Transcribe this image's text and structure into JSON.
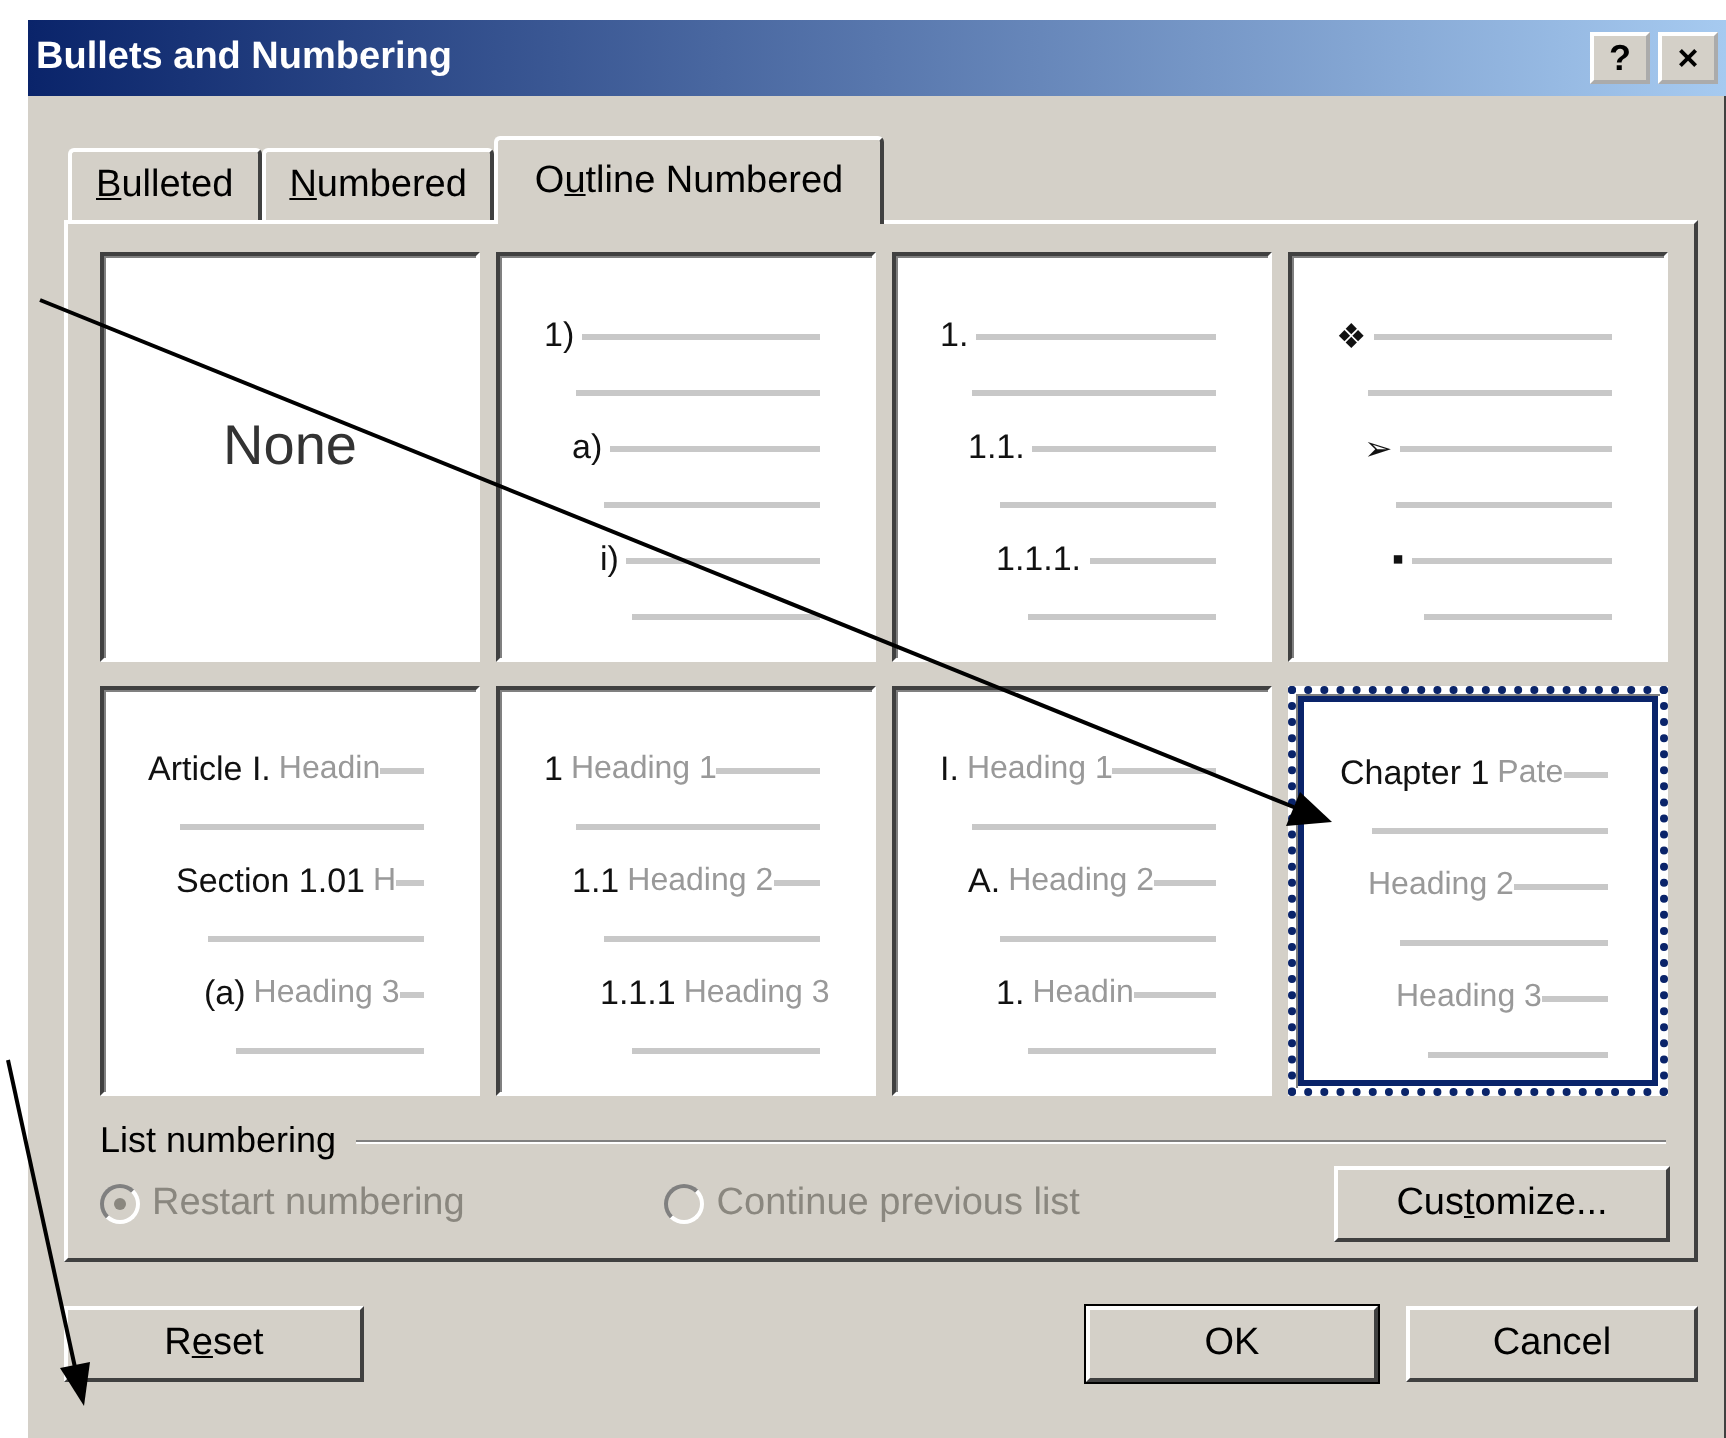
{
  "window": {
    "title": "Bullets and Numbering",
    "help_button": "?",
    "close_button": "×"
  },
  "tabs": [
    {
      "access_key": "B",
      "label_after": "ulleted",
      "selected": false
    },
    {
      "access_key": "N",
      "label_after": "umbered",
      "selected": false
    },
    {
      "label_before": "O",
      "access_key": "u",
      "label_after": "tline Numbered",
      "selected": true
    }
  ],
  "styles": [
    {
      "kind": "none",
      "label": "None",
      "selected": false
    },
    {
      "kind": "outline",
      "selected": false,
      "levels": [
        {
          "number": "1)"
        },
        {
          "number": "a)"
        },
        {
          "number": "i)"
        }
      ]
    },
    {
      "kind": "outline",
      "selected": false,
      "levels": [
        {
          "number": "1."
        },
        {
          "number": "1.1."
        },
        {
          "number": "1.1.1."
        }
      ]
    },
    {
      "kind": "outline",
      "selected": false,
      "levels": [
        {
          "number": "❖"
        },
        {
          "number": "➢"
        },
        {
          "number": "▪"
        }
      ]
    },
    {
      "kind": "outline",
      "selected": false,
      "levels": [
        {
          "number": "Article I.",
          "heading": "Headin"
        },
        {
          "number": "Section 1.01",
          "heading": "H"
        },
        {
          "number": "(a)",
          "heading": "Heading 3"
        }
      ]
    },
    {
      "kind": "outline",
      "selected": false,
      "levels": [
        {
          "number": "1",
          "heading": "Heading 1"
        },
        {
          "number": "1.1",
          "heading": "Heading 2"
        },
        {
          "number": "1.1.1",
          "heading": "Heading 3"
        }
      ]
    },
    {
      "kind": "outline",
      "selected": false,
      "levels": [
        {
          "number": "I.",
          "heading": "Heading 1"
        },
        {
          "number": "A.",
          "heading": "Heading 2"
        },
        {
          "number": "1.",
          "heading": "Headin"
        }
      ]
    },
    {
      "kind": "outline",
      "selected": true,
      "levels": [
        {
          "number": "Chapter 1",
          "heading": "Pate"
        },
        {
          "heading": "Heading 2"
        },
        {
          "heading": "Heading 3"
        }
      ]
    }
  ],
  "list_numbering": {
    "label": "List numbering",
    "options": [
      {
        "label": "Restart numbering",
        "selected": true,
        "disabled": true
      },
      {
        "label": "Continue previous list",
        "selected": false,
        "disabled": true
      }
    ],
    "customize_button": {
      "label_before": "Cus",
      "access_key": "t",
      "label_after": "omize..."
    }
  },
  "buttons": [
    {
      "kind": "reset",
      "label_before": "R",
      "access_key": "e",
      "label_after": "set",
      "default": false
    },
    {
      "kind": "ok",
      "label_before": "OK",
      "default": true
    },
    {
      "kind": "cancel",
      "label_before": "Cancel",
      "default": false
    }
  ]
}
